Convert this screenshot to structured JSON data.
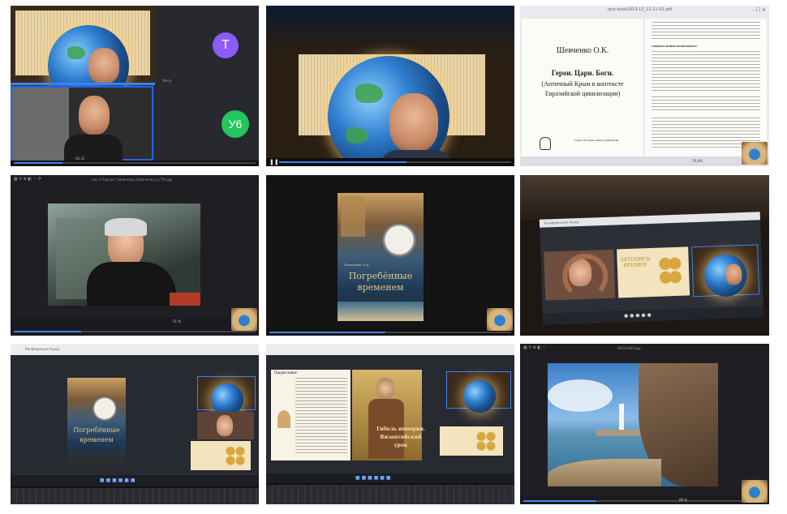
{
  "tiles": {
    "t1": {
      "avatar_t": "T",
      "avatar_u6": "У6",
      "avatar_t_color": "#8b5cf6",
      "avatar_u6_color": "#22c55e",
      "tile_caption_top": "Ингу",
      "tile_caption_bottom": "42:31"
    },
    "t3": {
      "title_bar": "ipro-book2023-12_12-11-01.pdf",
      "author": "Шевченко О.К.",
      "book_title_1": "Герои. Цари. Боги.",
      "book_title_2": "(Античный Крым в контексте",
      "book_title_3": "Евразийской цивилизации)",
      "series": "Серия: История и Философия Науки",
      "reviewers_heading": "ОФИЦИАЛЬНЫЕ РЕЦЕНЗЕНТЫ",
      "zoom": "76,9%"
    },
    "t4": {
      "title_bar": "поз.1.Портрет_Шевченко_Шевченко_п_ГТК.jpg",
      "zoom": "51 %"
    },
    "t5": {
      "cover_title_1": "Погребённые",
      "cover_title_2": "временем",
      "cover_author": "Шевченко О.К."
    },
    "t6": {
      "tab_label": "Конференция Ашод",
      "poster_line": "ЛЕТОПИСЬ ВРЕМЕН"
    },
    "t7": {
      "tab_label": "Конференция Ашод",
      "cover_title_1": "Погребённые",
      "cover_title_2": "временем"
    },
    "t8": {
      "section": "Предисловие",
      "fresco_title_1": "Гибель империи.",
      "fresco_title_2": "Византийский",
      "fresco_title_3": "урок"
    },
    "t9": {
      "title_bar": "DSC03449.jpg",
      "zoom": "66 %"
    }
  },
  "colors": {
    "accent": "#3b82f6",
    "tile_bg_dark": "#1a1a1a",
    "zoom_bg": "#2a2d33"
  }
}
